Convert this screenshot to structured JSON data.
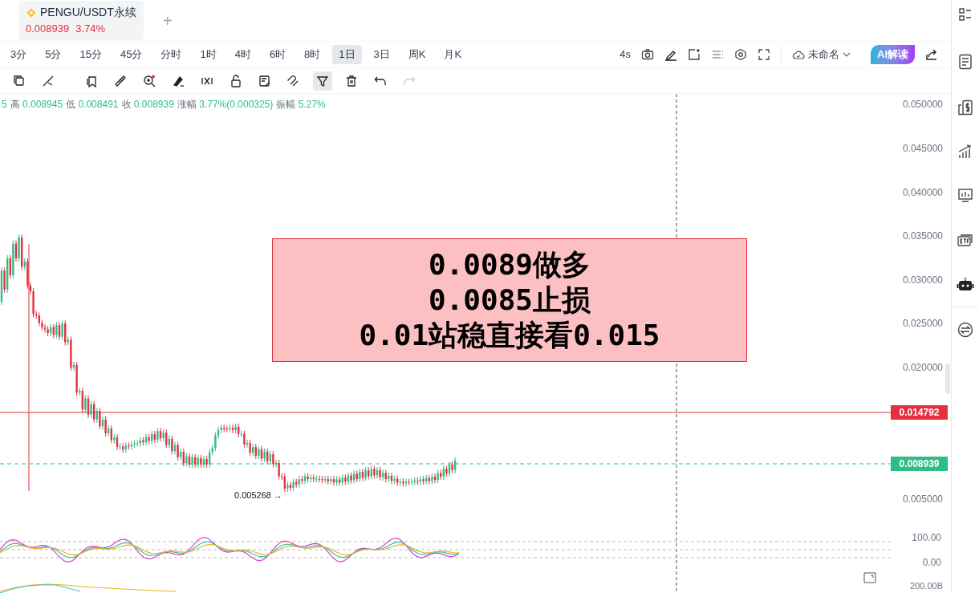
{
  "tab": {
    "symbol": "PENGU/USDT永续",
    "price": "0.008939",
    "change": "3.74%"
  },
  "add_tab": "+",
  "timeframes": [
    {
      "label": "3分",
      "selected": false
    },
    {
      "label": "5分",
      "selected": false
    },
    {
      "label": "15分",
      "selected": false
    },
    {
      "label": "45分",
      "selected": false
    },
    {
      "label": "分时",
      "selected": false
    },
    {
      "label": "1时",
      "selected": false
    },
    {
      "label": "4时",
      "selected": false
    },
    {
      "label": "6时",
      "selected": false
    },
    {
      "label": "8时",
      "selected": false
    },
    {
      "label": "1日",
      "selected": true
    },
    {
      "label": "3日",
      "selected": false
    },
    {
      "label": "周K",
      "selected": false
    },
    {
      "label": "月K",
      "selected": false
    }
  ],
  "toolbar": {
    "interval": "4s",
    "layout_name": "未命名",
    "ai_button": "AI解读"
  },
  "drawing_tools": [
    {
      "selected": false,
      "disabled": false
    },
    {
      "selected": false,
      "disabled": false
    },
    {
      "selected": false,
      "disabled": false
    },
    {
      "selected": false,
      "disabled": false
    },
    {
      "selected": false,
      "disabled": false
    },
    {
      "selected": false,
      "disabled": false
    },
    {
      "selected": false,
      "disabled": false
    },
    {
      "selected": false,
      "disabled": false
    },
    {
      "selected": false,
      "disabled": false
    },
    {
      "selected": false,
      "disabled": false
    },
    {
      "selected": true,
      "disabled": false
    },
    {
      "selected": false,
      "disabled": false
    },
    {
      "selected": false,
      "disabled": false
    },
    {
      "selected": false,
      "disabled": true
    }
  ],
  "legend": [
    {
      "value": "5"
    },
    {
      "label": "高",
      "value": "0.008945"
    },
    {
      "label": "低",
      "value": "0.008491"
    },
    {
      "label": "收",
      "value": "0.008939"
    },
    {
      "label": "涨幅",
      "value": "3.77%(0.000325)"
    },
    {
      "label": "振幅",
      "value": "5.27%"
    }
  ],
  "annotation": [
    "0.0089做多",
    "0.0085止损",
    "0.01站稳直接看0.015"
  ],
  "price_axis": [
    "0.050000",
    "0.045000",
    "0.040000",
    "0.035000",
    "0.030000",
    "0.025000",
    "0.020000",
    "0.005000"
  ],
  "price_tags": [
    {
      "value": "0.014792",
      "color": "#e5303f"
    },
    {
      "value": "0.008939",
      "color": "#2ebd85"
    }
  ],
  "low_marker": "0.005268 →",
  "oscillator_axis": [
    "100.00",
    "0.00"
  ],
  "volume_axis": "200.00B"
}
